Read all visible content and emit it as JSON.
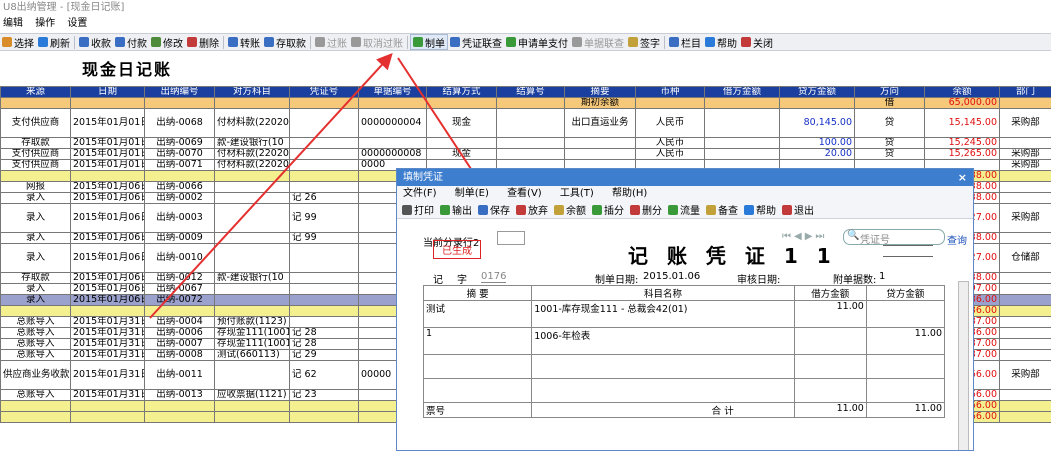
{
  "window_title": "U8出纳管理 - [现金日记账]",
  "menu": [
    "编辑",
    "操作",
    "设置"
  ],
  "toolbar": [
    {
      "label": "选择",
      "color": "#d98c2a"
    },
    {
      "label": "刷新",
      "color": "#2a7bd9"
    },
    {
      "label": "收款",
      "color": "#3a6ec2"
    },
    {
      "label": "付款",
      "color": "#3a6ec2"
    },
    {
      "label": "修改",
      "color": "#4d8a3a"
    },
    {
      "label": "删除",
      "color": "#c23a3a"
    },
    {
      "label": "转账",
      "color": "#3a6ec2"
    },
    {
      "label": "存取款",
      "color": "#3a6ec2"
    },
    {
      "label": "过账",
      "color": "#999999"
    },
    {
      "label": "取消过账",
      "color": "#999999"
    },
    {
      "label": "制单",
      "color": "#3a9a3a"
    },
    {
      "label": "凭证联查",
      "color": "#3a6ec2"
    },
    {
      "label": "申请单支付",
      "color": "#3a9a3a"
    },
    {
      "label": "单据联查",
      "color": "#999999"
    },
    {
      "label": "签字",
      "color": "#c2a13a"
    },
    {
      "label": "栏目",
      "color": "#3a6ec2"
    },
    {
      "label": "帮助",
      "color": "#2a7bd9"
    },
    {
      "label": "关闭",
      "color": "#c23a3a"
    }
  ],
  "report_title": "现金日记账",
  "columns": [
    "来源",
    "日期",
    "出纳编号",
    "对方科目",
    "凭证号",
    "单据编号",
    "结算方式",
    "结算号",
    "摘要",
    "币种",
    "借方金额",
    "贷方金额",
    "方向",
    "余额",
    "部门"
  ],
  "rows": [
    [
      "",
      "",
      "",
      "",
      "",
      "",
      "",
      "",
      "期初余额",
      "",
      "",
      "",
      "借",
      "65,000.00",
      ""
    ],
    [
      "支付供应商",
      "2015年01月01日",
      "出纳-0068",
      "付材料款(22020",
      "",
      "0000000004",
      "现金",
      "",
      "出口直运业务",
      "人民币",
      "",
      "80,145.00",
      "贷",
      "15,145.00",
      "采购部"
    ],
    [
      "存取款",
      "2015年01月01日",
      "出纳-0069",
      "款-建设银行(10",
      "",
      "",
      "",
      "",
      "",
      "人民币",
      "",
      "100.00",
      "贷",
      "15,245.00",
      ""
    ],
    [
      "支付供应商",
      "2015年01月01日",
      "出纳-0070",
      "付材料款(22020",
      "",
      "0000000008",
      "现金",
      "",
      "",
      "人民币",
      "",
      "20.00",
      "贷",
      "15,265.00",
      "采购部"
    ],
    [
      "支付供应商",
      "2015年01月01日",
      "出纳-0071",
      "付材料款(22020",
      "",
      "0000",
      "",
      "",
      "",
      "",
      "",
      "",
      "",
      "",
      "采购部"
    ],
    [
      "",
      "",
      "",
      "",
      "",
      "",
      "",
      "",
      "",
      "",
      "",
      "",
      "",
      "88.00",
      ""
    ],
    [
      "网报",
      "2015年01月06日",
      "出纳-0066",
      "",
      "",
      "",
      "",
      "",
      "",
      "",
      "",
      "",
      "",
      "38.00",
      ""
    ],
    [
      "录入",
      "2015年01月06日",
      "出纳-0002",
      "",
      "记 26",
      "",
      "",
      "",
      "",
      "",
      "",
      "",
      "",
      "38.00",
      ""
    ],
    [
      "录入",
      "2015年01月06日",
      "出纳-0003",
      "",
      "记 99",
      "",
      "",
      "",
      "",
      "",
      "",
      "",
      "",
      "27.00",
      "采购部"
    ],
    [
      "录入",
      "2015年01月06日",
      "出纳-0009",
      "",
      "记 99",
      "",
      "",
      "",
      "",
      "",
      "",
      "",
      "",
      "38.00",
      ""
    ],
    [
      "录入",
      "2015年01月06日",
      "出纳-0010",
      "",
      "",
      "",
      "",
      "",
      "",
      "",
      "",
      "",
      "",
      "27.00",
      "仓储部"
    ],
    [
      "存取款",
      "2015年01月06日",
      "出纳-0012",
      "款-建设银行(10",
      "",
      "",
      "",
      "",
      "",
      "",
      "",
      "",
      "",
      "38.00",
      ""
    ],
    [
      "录入",
      "2015年01月06日",
      "出纳-0067",
      "",
      "",
      "",
      "",
      "",
      "",
      "",
      "",
      "",
      "",
      "97.00",
      ""
    ],
    [
      "录入",
      "2015年01月06日",
      "出纳-0072",
      "",
      "",
      "",
      "",
      "",
      "",
      "",
      "",
      "",
      "",
      "86.00",
      ""
    ],
    [
      "",
      "",
      "",
      "",
      "",
      "",
      "",
      "",
      "",
      "",
      "",
      "",
      "",
      "86.00",
      ""
    ],
    [
      "总账导入",
      "2015年01月31日",
      "出纳-0004",
      "预付账款(1123)",
      "",
      "",
      "",
      "",
      "",
      "",
      "",
      "",
      "",
      "87.00",
      ""
    ],
    [
      "总账导入",
      "2015年01月31日",
      "出纳-0006",
      "存现金111(1001",
      "记 28",
      "",
      "",
      "",
      "",
      "",
      "",
      "",
      "",
      "86.00",
      ""
    ],
    [
      "总账导入",
      "2015年01月31日",
      "出纳-0007",
      "存现金111(1001",
      "记 28",
      "",
      "",
      "",
      "",
      "",
      "",
      "",
      "",
      "87.00",
      ""
    ],
    [
      "总账导入",
      "2015年01月31日",
      "出纳-0008",
      "测试(660113)",
      "记 29",
      "",
      "",
      "",
      "",
      "",
      "",
      "",
      "",
      "87.00",
      ""
    ],
    [
      "供应商业务收款",
      "2015年01月31日",
      "出纳-0011",
      "",
      "记 62",
      "00000",
      "",
      "",
      "",
      "",
      "",
      "",
      "",
      "66.00",
      "采购部"
    ],
    [
      "总账导入",
      "2015年01月31日",
      "出纳-0013",
      "应收票据(1121)",
      "记 23",
      "",
      "",
      "",
      "",
      "",
      "",
      "",
      "",
      "66.00",
      ""
    ],
    [
      "",
      "",
      "",
      "",
      "",
      "",
      "",
      "",
      "",
      "",
      "",
      "",
      "",
      "66.00",
      ""
    ],
    [
      "",
      "",
      "",
      "",
      "",
      "",
      "",
      "",
      "",
      "",
      "",
      "",
      "",
      "66.00",
      ""
    ]
  ],
  "dialog": {
    "title": "填制凭证",
    "close": "×",
    "menu": [
      "文件(F)",
      "制单(E)",
      "查看(V)",
      "工具(T)",
      "帮助(H)"
    ],
    "toolbar": [
      "打印",
      "输出",
      "保存",
      "放弃",
      "余额",
      "插分",
      "删分",
      "流量",
      "备查",
      "帮助",
      "退出"
    ],
    "current_row_label": "当前分录行2",
    "search_placeholder": "凭证号",
    "search_btn": "查询",
    "stamp": "已生成",
    "voucher_title": "记 账 凭 证 1 1",
    "voucher_type": "记",
    "zi_label": "字",
    "voucher_no": "0176",
    "date_label": "制单日期:",
    "date": "2015.01.06",
    "audit_label": "审核日期:",
    "attach_label": "附单据数:",
    "attach": "1",
    "col_summary": "摘 要",
    "col_account": "科目名称",
    "col_debit": "借方金额",
    "col_credit": "贷方金额",
    "entries": [
      {
        "summary": "测试",
        "account": "1001-库存现金111 - 总裁会42(01)",
        "debit": "11.00",
        "credit": ""
      },
      {
        "summary": "1",
        "account": "1006-年检表",
        "debit": "",
        "credit": "11.00"
      },
      {
        "summary": "",
        "account": "",
        "debit": "",
        "credit": ""
      },
      {
        "summary": "",
        "account": "",
        "debit": "",
        "credit": ""
      }
    ],
    "ticket_label": "票号",
    "total_label": "合 计",
    "total_debit": "11.00",
    "total_credit": "11.00"
  }
}
